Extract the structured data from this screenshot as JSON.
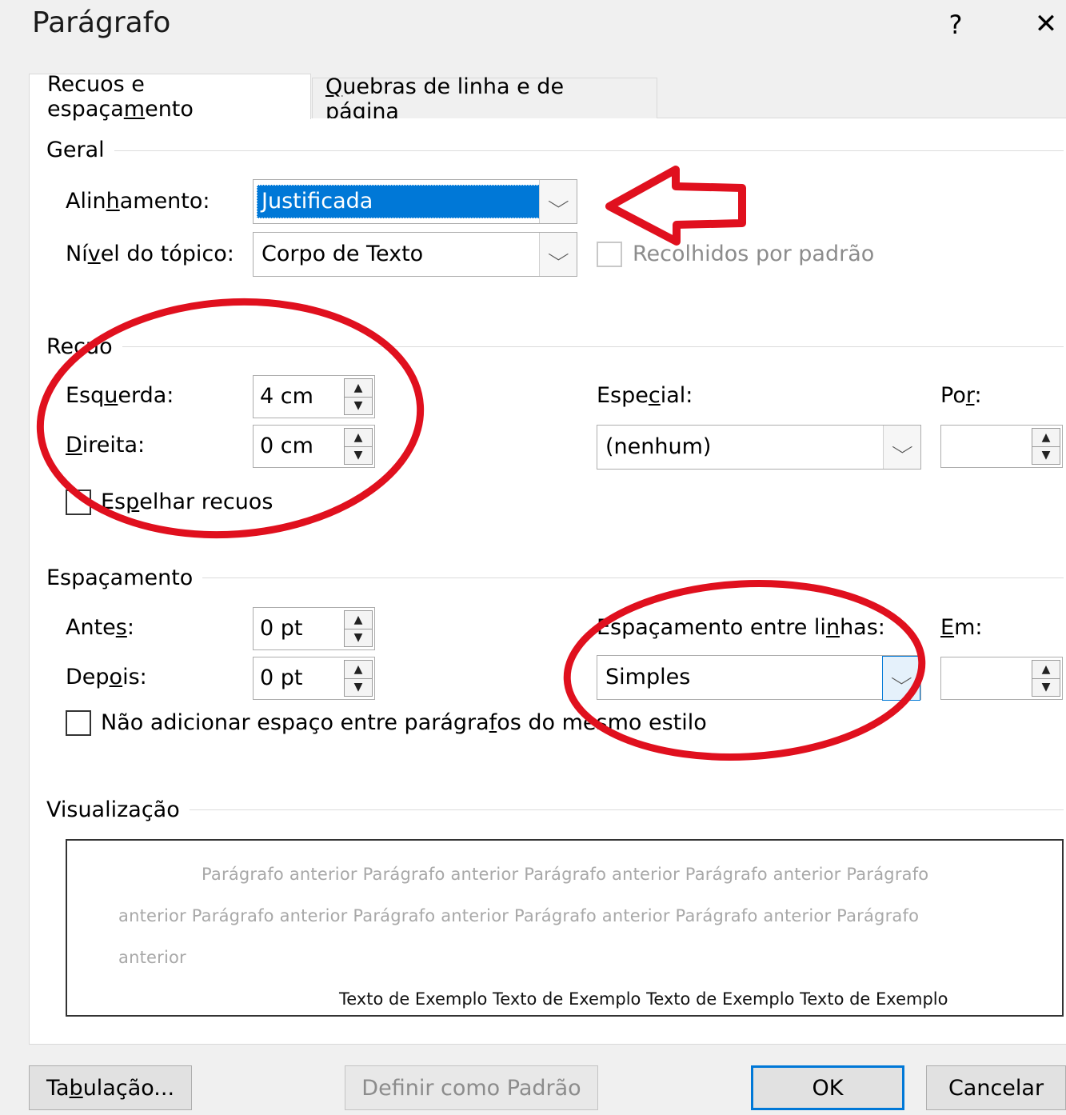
{
  "dialog": {
    "title": "Parágrafo",
    "help_glyph": "?",
    "close_glyph": "✕"
  },
  "tabs": [
    {
      "label_pre": "Recuos e espaça",
      "label_key": "m",
      "label_post": "ento"
    },
    {
      "label_pre": "",
      "label_key": "Q",
      "label_post": "uebras de linha e de página"
    }
  ],
  "geral": {
    "section_title": "Geral",
    "alinhamento_label_pre": "Alin",
    "alinhamento_label_key": "h",
    "alinhamento_label_post": "amento:",
    "alinhamento_value": "Justificada",
    "nivel_label_pre": "Ní",
    "nivel_label_key": "v",
    "nivel_label_post": "el do tópico:",
    "nivel_value": "Corpo de Texto",
    "recolhidos_label": "Recolhidos por padrão"
  },
  "recuo": {
    "section_title": "Recuo",
    "esquerda_label_pre": "Esq",
    "esquerda_label_key": "u",
    "esquerda_label_post": "erda:",
    "esquerda_value": "4 cm",
    "direita_label_pre": "",
    "direita_label_key": "D",
    "direita_label_post": "ireita:",
    "direita_value": "0 cm",
    "especial_label_pre": "Espe",
    "especial_label_key": "c",
    "especial_label_post": "ial:",
    "especial_value": "(nenhum)",
    "por_label_pre": "Po",
    "por_label_key": "r",
    "por_label_post": ":",
    "por_value": "",
    "espelhar_label_pre": "Es",
    "espelhar_label_key": "p",
    "espelhar_label_post": "elhar recuos"
  },
  "espacamento": {
    "section_title": "Espaçamento",
    "antes_label_pre": "Ante",
    "antes_label_key": "s",
    "antes_label_post": ":",
    "antes_value": "0 pt",
    "depois_label_pre": "Dep",
    "depois_label_key": "o",
    "depois_label_post": "is:",
    "depois_value": "0 pt",
    "entre_linhas_label_pre": "Espaçamento entre li",
    "entre_linhas_label_key": "n",
    "entre_linhas_label_post": "has:",
    "entre_linhas_value": "Simples",
    "em_label_pre": "",
    "em_label_key": "E",
    "em_label_post": "m:",
    "em_value": "",
    "nao_adicionar_pre": "Não adicionar espaço entre parágra",
    "nao_adicionar_key": "f",
    "nao_adicionar_post": "os do mesmo estilo"
  },
  "visualizacao": {
    "section_title": "Visualização",
    "prev_line1": "Parágrafo anterior Parágrafo anterior Parágrafo anterior Parágrafo anterior Parágrafo",
    "prev_line2": "anterior Parágrafo anterior Parágrafo anterior Parágrafo anterior Parágrafo anterior Parágrafo",
    "prev_line3": "anterior",
    "sample_line": "Texto de Exemplo Texto de Exemplo Texto de Exemplo Texto de Exemplo"
  },
  "buttons": {
    "tabulacao_pre": "Ta",
    "tabulacao_key": "b",
    "tabulacao_post": "ulação...",
    "definir_padrao": "Definir como Padrão",
    "ok": "OK",
    "cancelar": "Cancelar"
  },
  "annotations": {
    "color": "#e0101e"
  }
}
